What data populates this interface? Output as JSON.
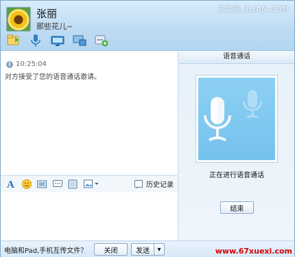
{
  "contact": {
    "name": "张丽",
    "signature": "那些花儿~"
  },
  "watermark_top": "三联网 3LIAN.COM",
  "header_toolbar": [
    {
      "icon": "file-transfer-icon"
    },
    {
      "icon": "microphone-icon"
    },
    {
      "icon": "video-call-icon"
    },
    {
      "icon": "remote-desktop-icon"
    },
    {
      "icon": "add-app-icon"
    }
  ],
  "chat": {
    "message_time": "10:25:04",
    "message_text": "对方接受了您的语音通话邀请。"
  },
  "input_toolbar": {
    "history_label": "历史记录"
  },
  "bottom_bar": {
    "transfer_text": "电脑和Pad,手机互传文件？",
    "close_label": "关闭",
    "send_label": "发送",
    "send_dropdown": "▾"
  },
  "voice_panel": {
    "title": "语音通话",
    "status": "正在进行语音通话",
    "end_label": "结束"
  },
  "site_watermark": "www.67xuexi.com",
  "colors": {
    "header_bg": "#bfdcf3",
    "voice_box": "#74c2ee",
    "watermark_red": "#d40000"
  }
}
